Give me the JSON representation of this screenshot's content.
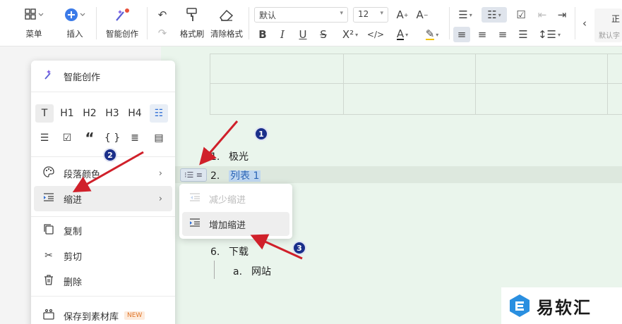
{
  "toolbar": {
    "menu_label": "菜单",
    "insert_label": "插入",
    "ai_label": "智能创作",
    "format_painter_label": "格式刷",
    "clear_format_label": "清除格式",
    "font_value": "默认",
    "size_value": "12",
    "right_cut_top": "正",
    "right_cut_bottom": "默认字"
  },
  "document": {
    "items": [
      {
        "num": "1.",
        "text": "极光"
      },
      {
        "num": "2.",
        "text": "列表 1"
      },
      {
        "num": "6.",
        "text": "下载"
      },
      {
        "num": "a.",
        "text": "网站"
      }
    ]
  },
  "context_menu": {
    "ai_label": "智能创作",
    "paragraph_color": "段落颜色",
    "indent": "缩进",
    "copy": "复制",
    "cut": "剪切",
    "delete": "删除",
    "save_to_library": "保存到素材库",
    "new_badge": "NEW",
    "grid_row1": [
      "T",
      "H1",
      "H2",
      "H3",
      "H4"
    ],
    "grid_row2_quote": "“",
    "grid_row2_braces": "{ }"
  },
  "submenu": {
    "decrease": "减少缩进",
    "increase": "增加缩进"
  },
  "annotations": {
    "b1": "1",
    "b2": "2",
    "b3": "3",
    "arrow_color": "#d0202a"
  },
  "watermark": {
    "text": "易软汇"
  }
}
